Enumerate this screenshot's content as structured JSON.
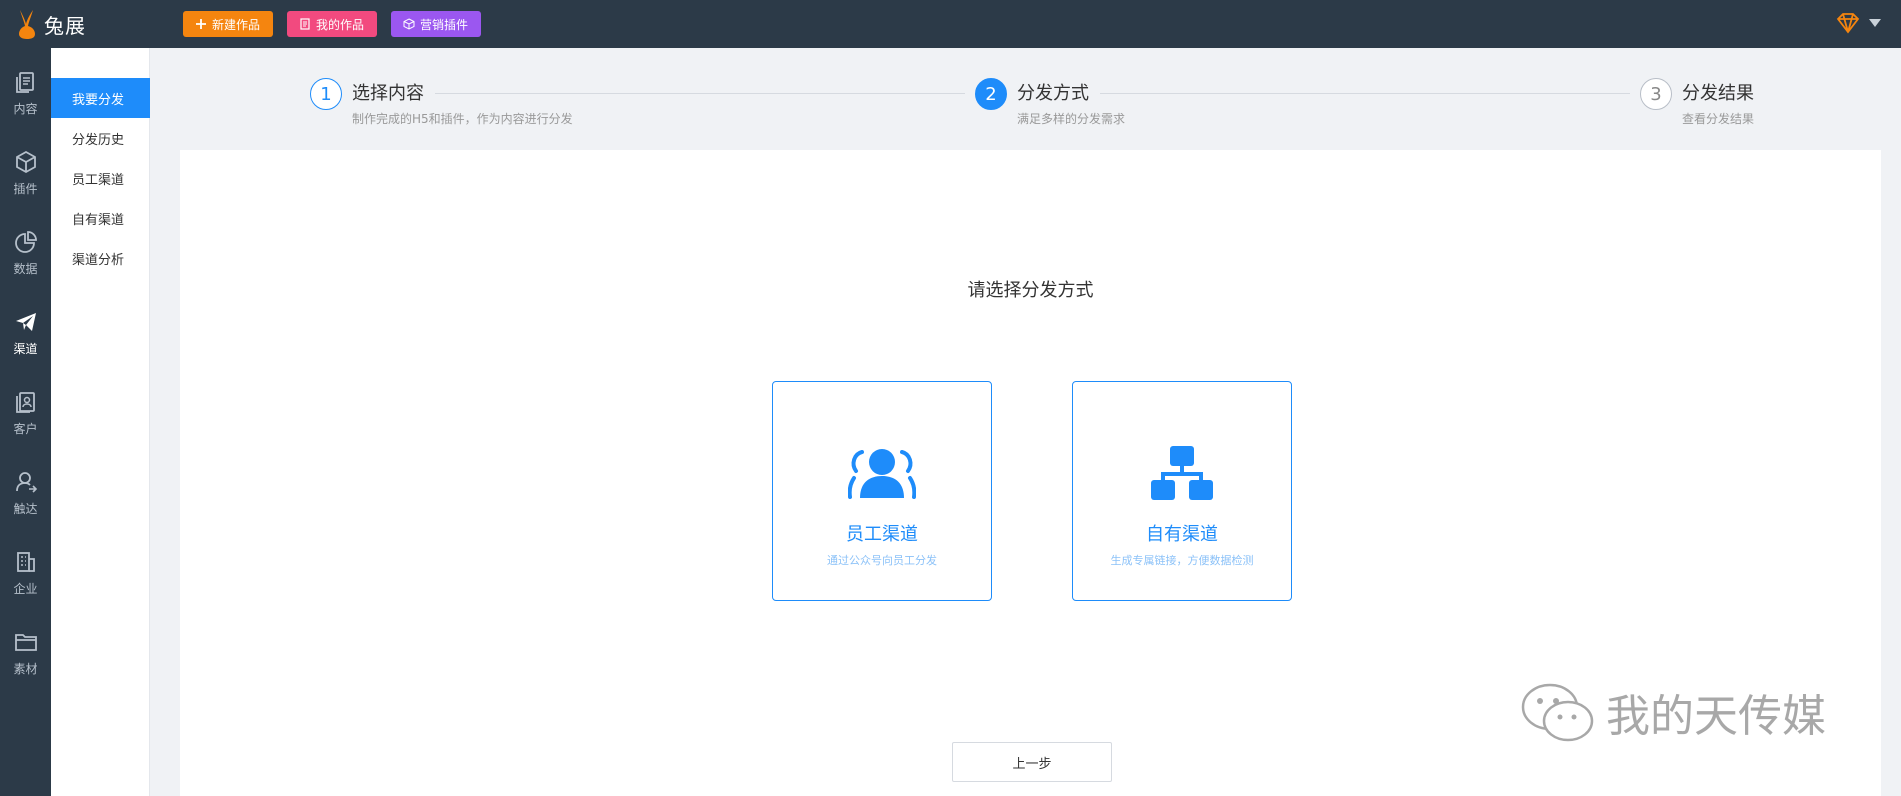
{
  "app": {
    "logo_text": "兔展"
  },
  "topbar": {
    "new_work": "新建作品",
    "my_works": "我的作品",
    "marketing_plugin": "营销插件"
  },
  "rail": [
    {
      "label": "内容",
      "icon": "content-icon"
    },
    {
      "label": "插件",
      "icon": "plugin-icon"
    },
    {
      "label": "数据",
      "icon": "data-icon"
    },
    {
      "label": "渠道",
      "icon": "channel-icon",
      "active": true
    },
    {
      "label": "客户",
      "icon": "customer-icon"
    },
    {
      "label": "触达",
      "icon": "reach-icon"
    },
    {
      "label": "企业",
      "icon": "enterprise-icon"
    },
    {
      "label": "素材",
      "icon": "material-icon"
    }
  ],
  "subnav": [
    {
      "label": "我要分发",
      "active": true
    },
    {
      "label": "分发历史"
    },
    {
      "label": "员工渠道"
    },
    {
      "label": "自有渠道"
    },
    {
      "label": "渠道分析"
    }
  ],
  "steps": [
    {
      "number": "1",
      "title": "选择内容",
      "desc": "制作完成的H5和插件，作为内容进行分发",
      "state": "done"
    },
    {
      "number": "2",
      "title": "分发方式",
      "desc": "满足多样的分发需求",
      "state": "active"
    },
    {
      "number": "3",
      "title": "分发结果",
      "desc": "查看分发结果",
      "state": "pending"
    }
  ],
  "main": {
    "prompt": "请选择分发方式",
    "cards": [
      {
        "title": "员工渠道",
        "desc": "通过公众号向员工分发",
        "icon": "users-icon"
      },
      {
        "title": "自有渠道",
        "desc": "生成专属链接，方便数据检测",
        "icon": "org-chart-icon"
      }
    ],
    "prev_button": "上一步"
  },
  "watermark": {
    "text": "我的天传媒"
  },
  "colors": {
    "topbar_bg": "#2c3a48",
    "primary": "#1e8cfa",
    "btn_new": "#f5850f",
    "btn_mine": "#f24a7f",
    "btn_plugin": "#9b57f0",
    "logo_orange": "#f5850f"
  }
}
